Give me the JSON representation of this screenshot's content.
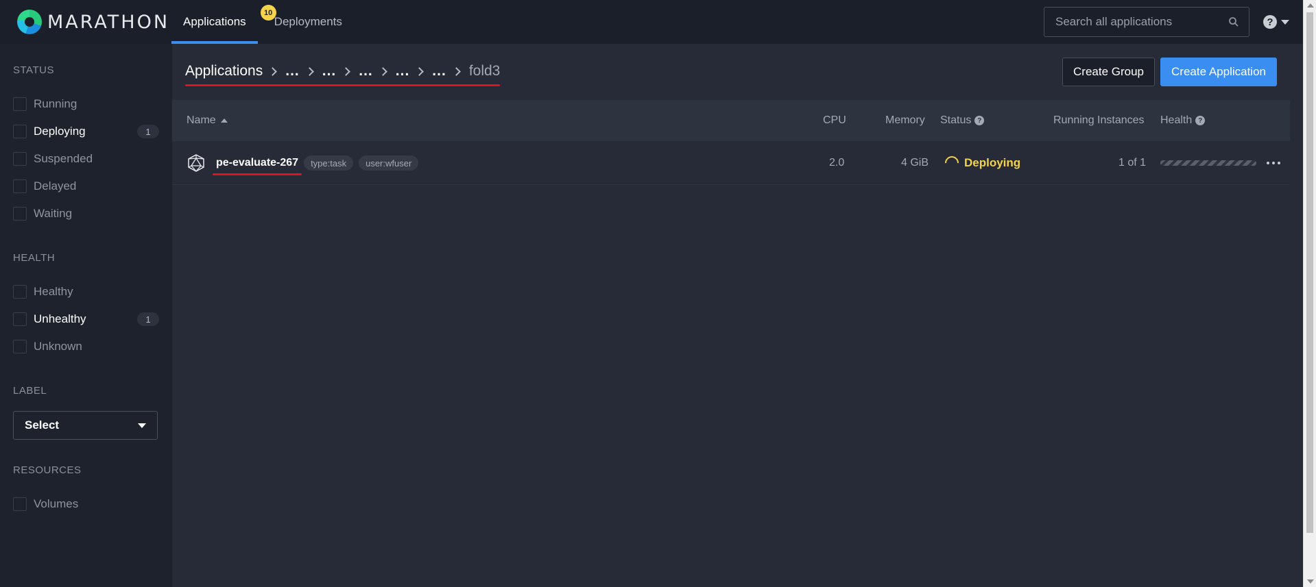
{
  "app": {
    "name": "MARATHON"
  },
  "nav": {
    "tabs": [
      {
        "label": "Applications",
        "active": true
      },
      {
        "label": "Deployments",
        "badge": "10"
      }
    ]
  },
  "search": {
    "placeholder": "Search all applications",
    "value": ""
  },
  "help": {
    "icon": "question-circle-icon",
    "label": "?"
  },
  "sidebar": {
    "status": {
      "heading": "STATUS",
      "items": [
        {
          "label": "Running",
          "count": ""
        },
        {
          "label": "Deploying",
          "count": "1"
        },
        {
          "label": "Suspended",
          "count": ""
        },
        {
          "label": "Delayed",
          "count": ""
        },
        {
          "label": "Waiting",
          "count": ""
        }
      ]
    },
    "health": {
      "heading": "HEALTH",
      "items": [
        {
          "label": "Healthy",
          "count": ""
        },
        {
          "label": "Unhealthy",
          "count": "1"
        },
        {
          "label": "Unknown",
          "count": ""
        }
      ]
    },
    "label": {
      "heading": "LABEL",
      "select_value": "Select"
    },
    "resources": {
      "heading": "RESOURCES",
      "items": [
        {
          "label": "Volumes",
          "count": ""
        }
      ]
    }
  },
  "breadcrumb": {
    "root": "Applications",
    "collapsed": [
      "...",
      "...",
      "...",
      "...",
      "..."
    ],
    "current": "fold3"
  },
  "actions": {
    "create_group": "Create Group",
    "create_application": "Create Application"
  },
  "table": {
    "columns": {
      "name": "Name",
      "cpu": "CPU",
      "memory": "Memory",
      "status": "Status",
      "running_instances": "Running Instances",
      "health": "Health"
    },
    "rows": [
      {
        "name": "pe-evaluate-267",
        "labels": [
          "type:task",
          "user:wfuser"
        ],
        "cpu": "2.0",
        "memory": "4 GiB",
        "status": "Deploying",
        "running_instances": "1 of 1",
        "health_unknown_fraction": 1.0
      }
    ]
  },
  "colors": {
    "accent": "#3a8ef2",
    "deploying": "#f4d34a",
    "annotation": "#e0141e"
  }
}
